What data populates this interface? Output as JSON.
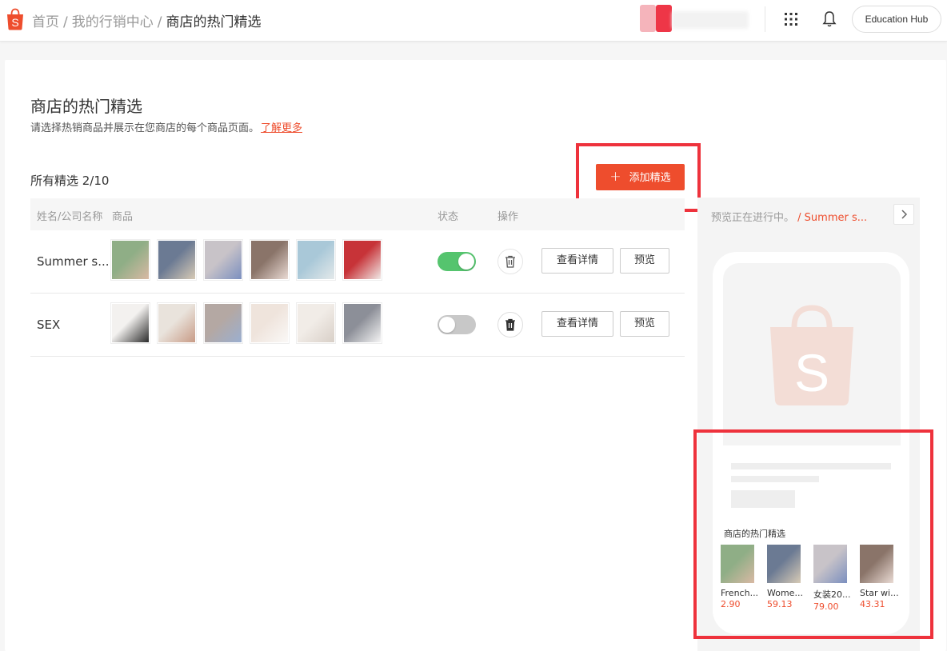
{
  "breadcrumb": {
    "items": [
      "首页",
      "我的行销中心",
      "商店的热门精选"
    ],
    "separator": "/"
  },
  "topbar": {
    "education_hub_label": "Education Hub"
  },
  "page": {
    "title": "商店的热门精选",
    "description": "请选择热销商品并展示在您商店的每个商品页面。",
    "learn_more": "了解更多",
    "all_collections": "所有精选 2/10",
    "add_button": "添加精选"
  },
  "table": {
    "headers": {
      "name": "姓名/公司名称",
      "products": "商品",
      "status": "状态",
      "actions": "操作"
    },
    "rows": [
      {
        "name": "Summer s...",
        "status_on": true,
        "view_label": "查看详情",
        "preview_label": "预览",
        "thumb_colors": [
          [
            "#8fae86",
            "#d9b9a4"
          ],
          [
            "#6b7a93",
            "#d8cbb6"
          ],
          [
            "#c8c3c8",
            "#7b8fbf"
          ],
          [
            "#8a7469",
            "#eadbd4"
          ],
          [
            "#a9c8d8",
            "#e4e9ea"
          ],
          [
            "#c73338",
            "#f0e9e7"
          ]
        ]
      },
      {
        "name": "SEX",
        "status_on": false,
        "view_label": "查看详情",
        "preview_label": "预览",
        "thumb_colors": [
          [
            "#f3f1ef",
            "#2b2b2b"
          ],
          [
            "#e9e3dc",
            "#c89b86"
          ],
          [
            "#b4a8a3",
            "#9bafd0"
          ],
          [
            "#efe4dc",
            "#faf8f6"
          ],
          [
            "#f1ece7",
            "#d8cfc7"
          ],
          [
            "#8c8f98",
            "#f4f4f4"
          ]
        ]
      }
    ]
  },
  "preview": {
    "status_text": "预览正在进行中。",
    "collection_name": "/ Summer s...",
    "section_title": "商店的热门精选",
    "items": [
      {
        "name": "French...",
        "price": "2.90",
        "colors": [
          "#8fae86",
          "#d9b9a4"
        ]
      },
      {
        "name": "Wome...",
        "price": "59.13",
        "colors": [
          "#6b7a93",
          "#d8cbb6"
        ]
      },
      {
        "name": "女装20...",
        "price": "79.00",
        "colors": [
          "#c8c3c8",
          "#7b8fbf"
        ]
      },
      {
        "name": "Star wi...",
        "price": "43.31",
        "colors": [
          "#8a7469",
          "#eadbd4"
        ]
      }
    ]
  },
  "colors": {
    "brand": "#ee4d2d",
    "toggle_on": "#55c46e",
    "toggle_off": "#c8c8c8",
    "highlight": "#ee323c"
  }
}
